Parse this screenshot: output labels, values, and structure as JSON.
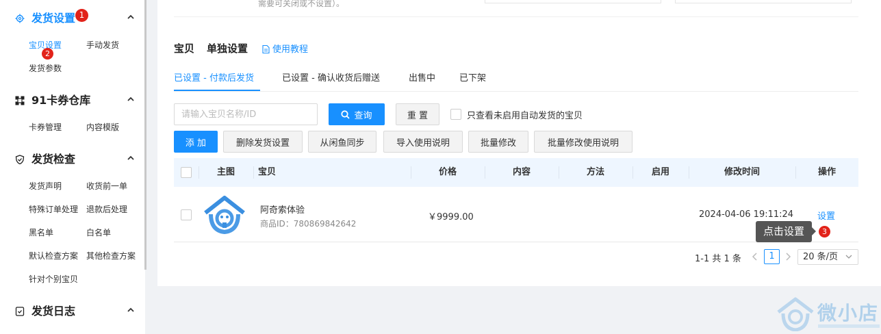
{
  "sidebar": {
    "sections": [
      {
        "title": "发货设置",
        "icon": "gear-icon",
        "badge": "1",
        "items": [
          "宝贝设置",
          "手动发货",
          "发货参数"
        ],
        "active_item_badge": "2"
      },
      {
        "title": "91卡券仓库",
        "icon": "grid-icon",
        "items": [
          "卡券管理",
          "内容模版"
        ]
      },
      {
        "title": "发货检查",
        "icon": "shield-icon",
        "items": [
          "发货声明",
          "收货前一单",
          "特殊订单处理",
          "退款后处理",
          "黑名单",
          "白名单",
          "默认检查方案",
          "其他检查方案",
          "针对个别宝贝"
        ]
      },
      {
        "title": "发货日志",
        "icon": "log-icon",
        "items": []
      }
    ]
  },
  "top": {
    "note": "需要可关闭或不设置）。"
  },
  "main": {
    "title_part1": "宝贝",
    "title_part2": "单独设置",
    "tutorial_label": "使用教程",
    "tabs": [
      "已设置 - 付款后发货",
      "已设置 - 确认收货后赠送",
      "出售中",
      "已下架"
    ],
    "active_tab_index": 0,
    "search": {
      "placeholder": "请输入宝贝名称/ID",
      "query_label": "查询",
      "reset_label": "重 置",
      "filter_label": "只查看未启用自动发货的宝贝"
    },
    "actions": [
      "添 加",
      "删除发货设置",
      "从闲鱼同步",
      "导入使用说明",
      "批量修改",
      "批量修改使用说明"
    ],
    "table": {
      "headers": [
        "主图",
        "宝贝",
        "价格",
        "内容",
        "方法",
        "启用",
        "修改时间",
        "操作"
      ],
      "rows": [
        {
          "name": "阿奇索体验",
          "item_id": "商品ID：780869842642",
          "price": "￥9999.00",
          "content": "",
          "method": "",
          "enabled": "",
          "modified": "2024-04-06 19:11:24",
          "action": "设置"
        }
      ]
    },
    "tooltip": {
      "text": "点击设置",
      "badge": "3"
    },
    "pagination": {
      "summary": "1-1 共 1 条",
      "current_page": "1",
      "page_size": "20 条/页"
    }
  },
  "watermark": {
    "text": "微小店"
  },
  "colors": {
    "accent": "#1890ff",
    "badge": "#e2231a",
    "tooltip_bg": "#555555",
    "header_bg": "#eef6ff"
  }
}
